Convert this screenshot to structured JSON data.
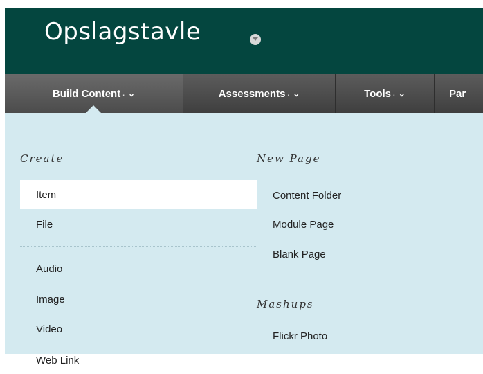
{
  "header": {
    "title": "Opslagstavle"
  },
  "toolbar": {
    "tabs": [
      {
        "label": "Build Content",
        "dot": ".",
        "chevron": "⌄"
      },
      {
        "label": "Assessments",
        "dot": ".",
        "chevron": "⌄"
      },
      {
        "label": "Tools",
        "dot": ".",
        "chevron": "⌄"
      },
      {
        "label": "Par"
      }
    ]
  },
  "menu": {
    "create": {
      "heading": "Create",
      "items": [
        "Item",
        "File",
        "Audio",
        "Image",
        "Video",
        "Web Link"
      ]
    },
    "new_page": {
      "heading": "New Page",
      "items": [
        "Content Folder",
        "Module Page",
        "Blank Page"
      ]
    },
    "mashups": {
      "heading": "Mashups",
      "items": [
        "Flickr Photo"
      ]
    }
  },
  "colors": {
    "header_bg": "#04463f",
    "toolbar_bg": "#4a4a4a",
    "dropdown_bg": "#d4eaf0",
    "selected_bg": "#ffffff"
  }
}
